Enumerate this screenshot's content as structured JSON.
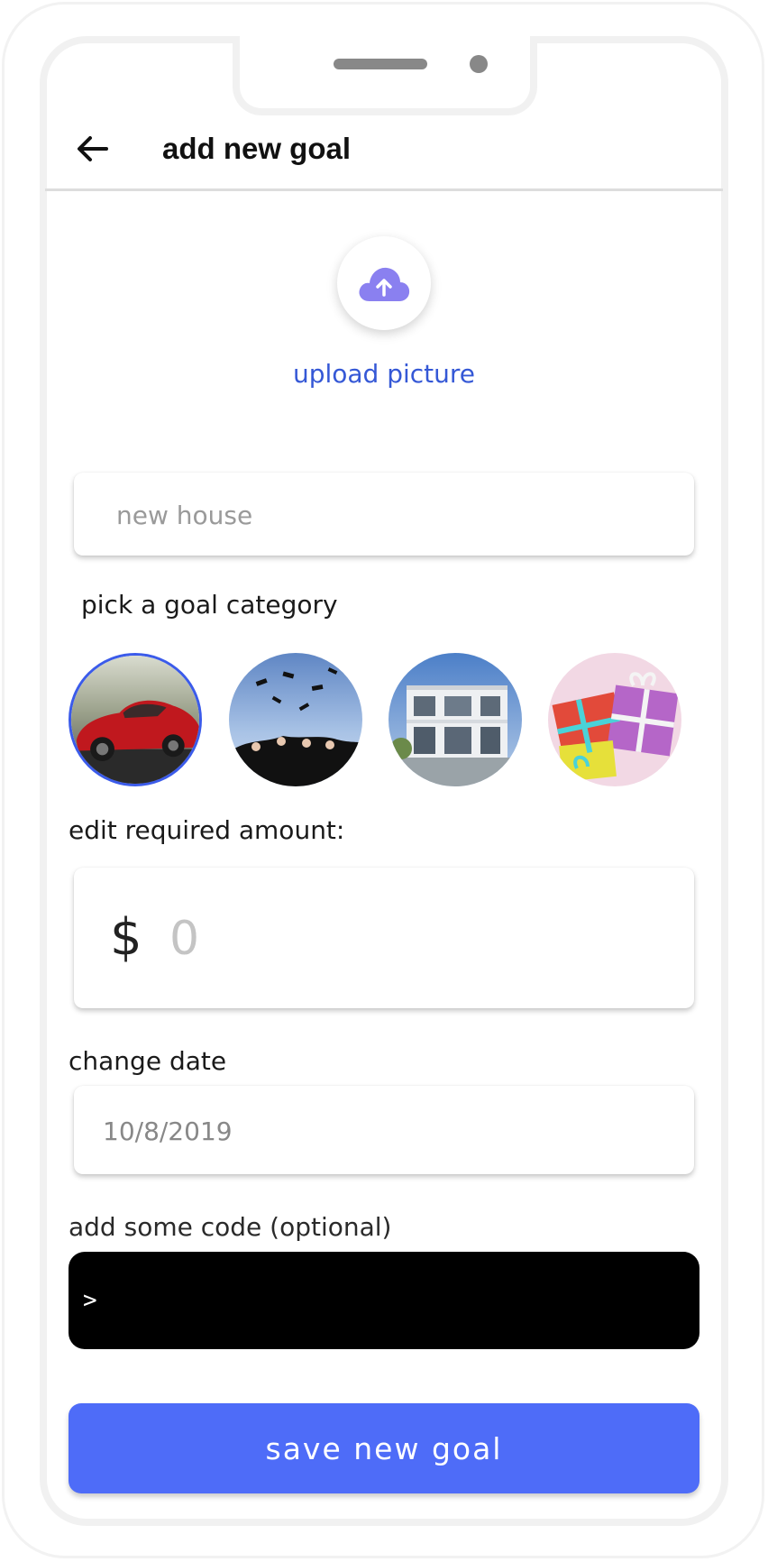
{
  "header": {
    "title": "add new goal"
  },
  "upload": {
    "label": "upload picture",
    "accent": "#8a80f0"
  },
  "goal_name": {
    "placeholder": "new house",
    "value": ""
  },
  "category": {
    "label": "pick a goal category",
    "items": [
      {
        "name": "car",
        "selected": true
      },
      {
        "name": "graduation",
        "selected": false
      },
      {
        "name": "house",
        "selected": false
      },
      {
        "name": "gift",
        "selected": false
      }
    ],
    "selected_color": "#3b5bea"
  },
  "amount": {
    "label": "edit required amount:",
    "currency": "$",
    "placeholder": "0",
    "value": ""
  },
  "date": {
    "label": "change date",
    "value": "10/8/2019"
  },
  "code": {
    "label": "add some code (optional)",
    "prompt": ">"
  },
  "save": {
    "label": "save new goal",
    "color": "#4e6cf8"
  },
  "icons": {
    "back": "arrow-left-icon",
    "upload": "cloud-upload-icon"
  }
}
